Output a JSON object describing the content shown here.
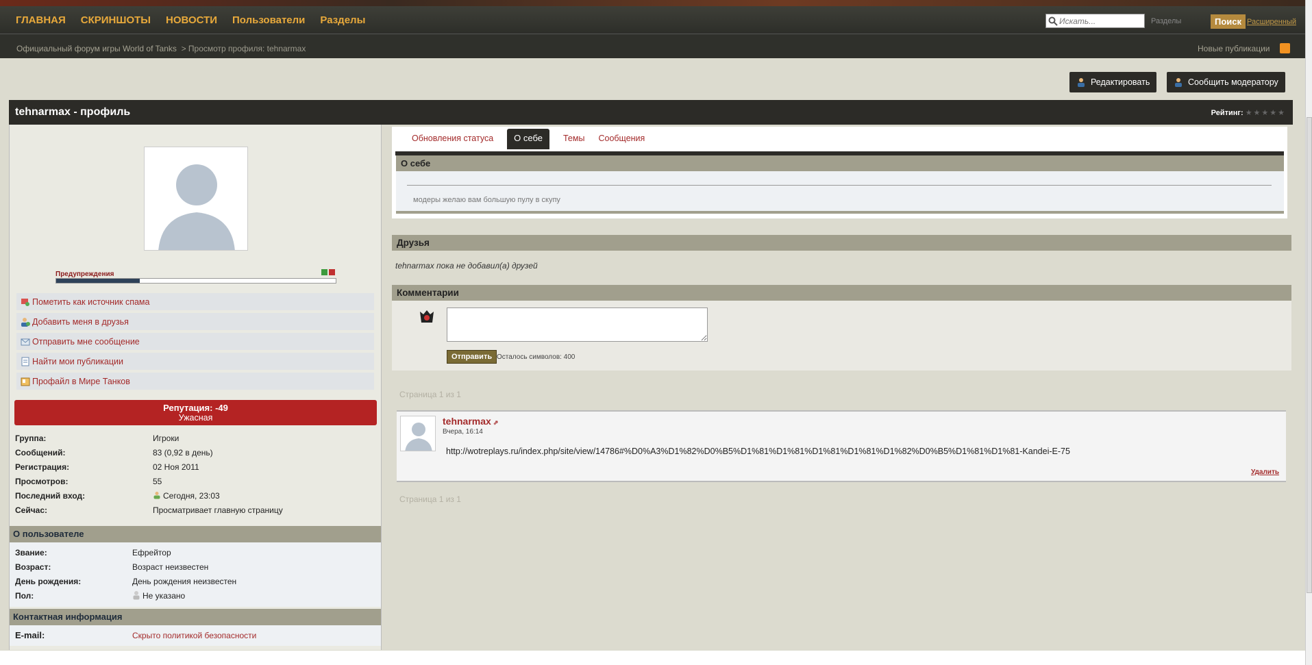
{
  "nav": {
    "items": [
      "ГЛАВНАЯ",
      "СКРИНШОТЫ",
      "НОВОСТИ",
      "Пользователи",
      "Разделы"
    ],
    "search_placeholder": "Искать...",
    "search_scope": "Разделы",
    "search_button": "Поиск",
    "advanced": "Расширенный"
  },
  "breadcrumb": {
    "home": "Официальный форум игры World of Tanks",
    "current": "> Просмотр профиля: tehnarmax",
    "new_publications": "Новые публикации"
  },
  "buttons": {
    "edit": "Редактировать",
    "report": "Сообщить модератору"
  },
  "profile": {
    "title": "tehnarmax - профиль",
    "rating_label": "Рейтинг:",
    "rating_stars": "★★★★★",
    "warnings_label": "Предупреждения",
    "warnings_level": 0.3,
    "actions": [
      "Пометить как источник спама",
      "Добавить меня в друзья",
      "Отправить мне сообщение",
      "Найти мои публикации",
      "Профайл в Мире Танков"
    ],
    "reputation": "Репутация: -49",
    "reputation_desc": "Ужасная",
    "stats": [
      {
        "k": "Группа:",
        "v": "Игроки"
      },
      {
        "k": "Сообщений:",
        "v": "83 (0,92 в день)"
      },
      {
        "k": "Регистрация:",
        "v": "02 Ноя 2011"
      },
      {
        "k": "Просмотров:",
        "v": "55"
      },
      {
        "k": "Последний вход:",
        "v": "Сегодня, 23:03"
      },
      {
        "k": "Сейчас:",
        "v": "Просматривает главную страницу"
      }
    ],
    "about_user_header": "О пользователе",
    "about_user": [
      {
        "k": "Звание:",
        "v": "Ефрейтор"
      },
      {
        "k": "Возраст:",
        "v": "Возраст неизвестен"
      },
      {
        "k": "День рождения:",
        "v": "День рождения неизвестен"
      },
      {
        "k": "Пол:",
        "v": "Не указано"
      }
    ],
    "contact_header": "Контактная информация",
    "email_label": "E-mail:",
    "email_value": "Скрыто политикой безопасности"
  },
  "tabs": [
    "Обновления статуса",
    "О себе",
    "Темы",
    "Сообщения"
  ],
  "about": {
    "header": "О себе",
    "text": "модеры желаю вам большую пулу в скупу"
  },
  "friends": {
    "header": "Друзья",
    "text": "tehnarmax пока не добавил(а) друзей"
  },
  "comments": {
    "header": "Комментарии",
    "send": "Отправить",
    "chars_left": "Осталось символов: 400"
  },
  "pagination": "Страница 1 из 1",
  "status": {
    "author": "tehnarmax",
    "date": "Вчера, 16:14",
    "text": "http://wotreplays.ru/index.php/site/view/14786#%D0%A3%D1%82%D0%B5%D1%81%D1%81%D1%81%D1%81%D1%82%D0%B5%D1%81%D1%81-Kandei-E-75",
    "delete": "Удалить"
  }
}
